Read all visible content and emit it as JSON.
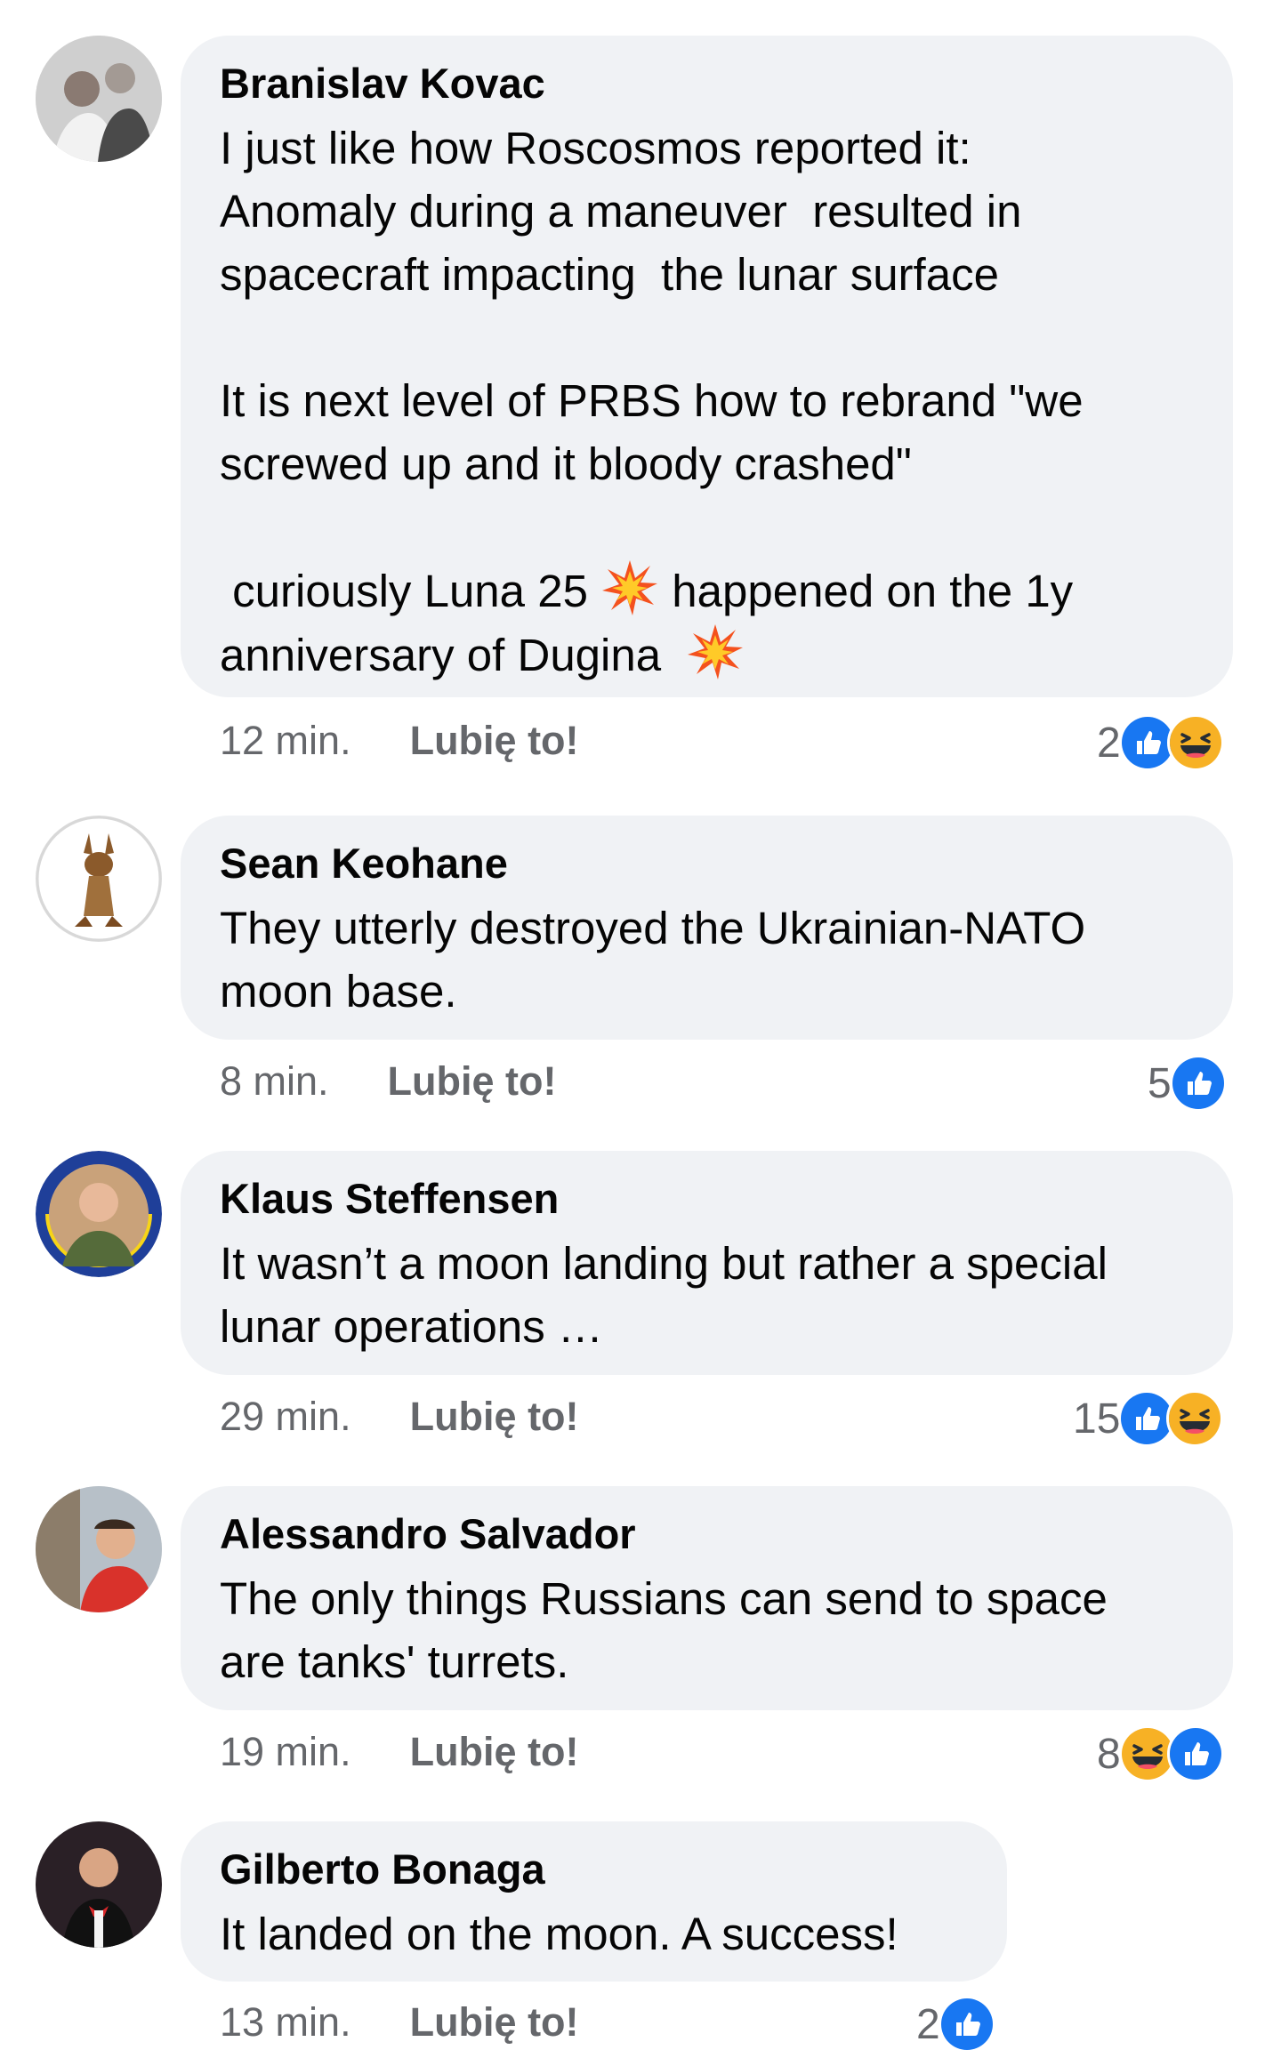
{
  "comments": [
    {
      "author": "Branislav Kovac",
      "paragraphs": [
        "I just like how Roscosmos reported it:\nAnomaly during a maneuver  resulted in\nspacecraft impacting  the lunar surface",
        "It is next level of PRBS how to rebrand \"we\nscrewed up and it bloody crashed\""
      ],
      "last_line_parts": [
        " curiously Luna 25 ",
        " happened on the 1y",
        "anniversary of Dugina  "
      ],
      "emoji_name": "collision-emoji",
      "time": "12 min.",
      "like_label": "Lubię to!",
      "reaction_count": "2",
      "reactions": [
        "like-icon",
        "haha-icon"
      ]
    },
    {
      "author": "Sean Keohane",
      "text": "They utterly destroyed the Ukrainian-NATO\nmoon base.",
      "time": "8 min.",
      "like_label": "Lubię to!",
      "reaction_count": "5",
      "reactions": [
        "like-icon"
      ]
    },
    {
      "author": "Klaus Steffensen",
      "text": "It wasn’t a moon landing but rather a special\nlunar operations …",
      "time": "29 min.",
      "like_label": "Lubię to!",
      "reaction_count": "15",
      "reactions": [
        "like-icon",
        "haha-icon"
      ]
    },
    {
      "author": "Alessandro Salvador",
      "text": "The only things Russians can send to space\nare tanks' turrets.",
      "time": "19 min.",
      "like_label": "Lubię to!",
      "reaction_count": "8",
      "reactions": [
        "haha-icon",
        "like-icon"
      ]
    },
    {
      "author": "Gilberto Bonaga",
      "text": "It landed on the moon. A success!",
      "time": "13 min.",
      "like_label": "Lubię to!",
      "reaction_count": "2",
      "reactions": [
        "like-icon"
      ]
    }
  ],
  "colors": {
    "bubble": "#f0f2f5",
    "meta_text": "#65676b",
    "like_blue": "#1877f2",
    "haha_yellow": "#f7b125"
  }
}
